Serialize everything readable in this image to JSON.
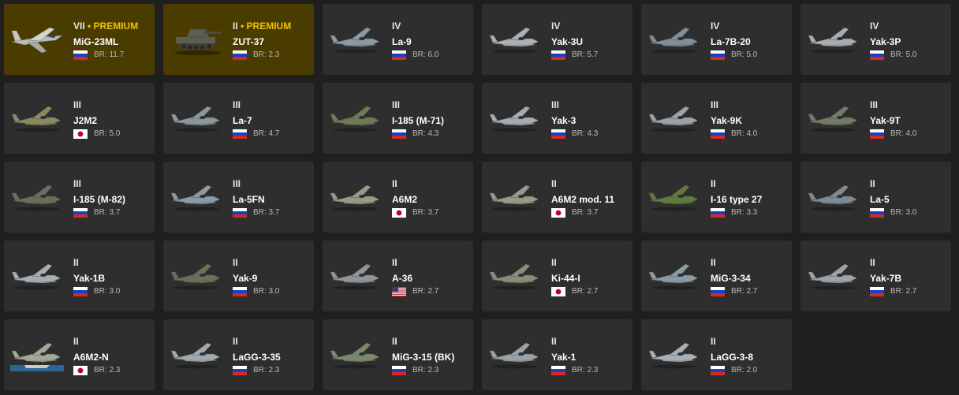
{
  "colors": {
    "page_bg": "#1f1f1f",
    "card_bg": "#2e2e2e",
    "premium_card_bg": "#4a3c00",
    "premium_text": "#f2c200"
  },
  "cards": [
    {
      "rank": "VII",
      "premium_label": "PREMIUM",
      "name": "MiG-23ML",
      "nation": "ussr",
      "br": "BR: 11.7",
      "kind": "jet",
      "camo": "#b9bcb8"
    },
    {
      "rank": "II",
      "premium_label": "PREMIUM",
      "name": "ZUT-37",
      "nation": "ussr",
      "br": "BR: 2.3",
      "kind": "tank",
      "camo": "#5c5e52"
    },
    {
      "rank": "IV",
      "premium_label": "",
      "name": "La-9",
      "nation": "ussr",
      "br": "BR: 6.0",
      "kind": "plane",
      "camo": "#8b9aa3"
    },
    {
      "rank": "IV",
      "premium_label": "",
      "name": "Yak-3U",
      "nation": "ussr",
      "br": "BR: 5.7",
      "kind": "plane",
      "camo": "#a9b1b6"
    },
    {
      "rank": "IV",
      "premium_label": "",
      "name": "La-7B-20",
      "nation": "ussr",
      "br": "BR: 5.0",
      "kind": "plane",
      "camo": "#7f8e98"
    },
    {
      "rank": "IV",
      "premium_label": "",
      "name": "Yak-3P",
      "nation": "ussr",
      "br": "BR: 5.0",
      "kind": "plane",
      "camo": "#a7adb2"
    },
    {
      "rank": "III",
      "premium_label": "",
      "name": "J2M2",
      "nation": "japan",
      "br": "BR: 5.0",
      "kind": "plane",
      "camo": "#8a8a5e"
    },
    {
      "rank": "III",
      "premium_label": "",
      "name": "La-7",
      "nation": "ussr",
      "br": "BR: 4.7",
      "kind": "plane",
      "camo": "#8c979e"
    },
    {
      "rank": "III",
      "premium_label": "",
      "name": "I-185 (M-71)",
      "nation": "ussr",
      "br": "BR: 4.3",
      "kind": "plane",
      "camo": "#6f7a52"
    },
    {
      "rank": "III",
      "premium_label": "",
      "name": "Yak-3",
      "nation": "ussr",
      "br": "BR: 4.3",
      "kind": "plane",
      "camo": "#a4adb2"
    },
    {
      "rank": "III",
      "premium_label": "",
      "name": "Yak-9K",
      "nation": "ussr",
      "br": "BR: 4.0",
      "kind": "plane",
      "camo": "#9aa3a8"
    },
    {
      "rank": "III",
      "premium_label": "",
      "name": "Yak-9T",
      "nation": "ussr",
      "br": "BR: 4.0",
      "kind": "plane",
      "camo": "#737a66"
    },
    {
      "rank": "III",
      "premium_label": "",
      "name": "I-185 (M-82)",
      "nation": "ussr",
      "br": "BR: 3.7",
      "kind": "plane",
      "camo": "#6a6e5a"
    },
    {
      "rank": "III",
      "premium_label": "",
      "name": "La-5FN",
      "nation": "ussr",
      "br": "BR: 3.7",
      "kind": "plane",
      "camo": "#8c9aa6"
    },
    {
      "rank": "II",
      "premium_label": "",
      "name": "A6M2",
      "nation": "japan",
      "br": "BR: 3.7",
      "kind": "plane",
      "camo": "#9c9a86"
    },
    {
      "rank": "II",
      "premium_label": "",
      "name": "A6M2 mod. 11",
      "nation": "japan",
      "br": "BR: 3.7",
      "kind": "plane",
      "camo": "#9a9886"
    },
    {
      "rank": "II",
      "premium_label": "",
      "name": "I-16 type 27",
      "nation": "ussr",
      "br": "BR: 3.3",
      "kind": "plane",
      "camo": "#5f7a3c"
    },
    {
      "rank": "II",
      "premium_label": "",
      "name": "La-5",
      "nation": "ussr",
      "br": "BR: 3.0",
      "kind": "plane",
      "camo": "#7f8b93"
    },
    {
      "rank": "II",
      "premium_label": "",
      "name": "Yak-1B",
      "nation": "ussr",
      "br": "BR: 3.0",
      "kind": "plane",
      "camo": "#a4aeb4"
    },
    {
      "rank": "II",
      "premium_label": "",
      "name": "Yak-9",
      "nation": "ussr",
      "br": "BR: 3.0",
      "kind": "plane",
      "camo": "#6c7058"
    },
    {
      "rank": "II",
      "premium_label": "",
      "name": "A-36",
      "nation": "usa",
      "br": "BR: 2.7",
      "kind": "plane",
      "camo": "#8f969a"
    },
    {
      "rank": "II",
      "premium_label": "",
      "name": "Ki-44-I",
      "nation": "japan",
      "br": "BR: 2.7",
      "kind": "plane",
      "camo": "#8e8a7a"
    },
    {
      "rank": "II",
      "premium_label": "",
      "name": "MiG-3-34",
      "nation": "ussr",
      "br": "BR: 2.7",
      "kind": "plane",
      "camo": "#8c9aa3"
    },
    {
      "rank": "II",
      "premium_label": "",
      "name": "Yak-7B",
      "nation": "ussr",
      "br": "BR: 2.7",
      "kind": "plane",
      "camo": "#9ba4a9"
    },
    {
      "rank": "II",
      "premium_label": "",
      "name": "A6M2-N",
      "nation": "japan",
      "br": "BR: 2.3",
      "kind": "floatplane",
      "camo": "#a3a896"
    },
    {
      "rank": "II",
      "premium_label": "",
      "name": "LaGG-3-35",
      "nation": "ussr",
      "br": "BR: 2.3",
      "kind": "plane",
      "camo": "#a0a9ae"
    },
    {
      "rank": "II",
      "premium_label": "",
      "name": "MiG-3-15 (BK)",
      "nation": "ussr",
      "br": "BR: 2.3",
      "kind": "plane",
      "camo": "#7a8a6a"
    },
    {
      "rank": "II",
      "premium_label": "",
      "name": "Yak-1",
      "nation": "ussr",
      "br": "BR: 2.3",
      "kind": "plane",
      "camo": "#9aa2a6"
    },
    {
      "rank": "II",
      "premium_label": "",
      "name": "LaGG-3-8",
      "nation": "ussr",
      "br": "BR: 2.0",
      "kind": "plane",
      "camo": "#a7b0b5"
    }
  ]
}
